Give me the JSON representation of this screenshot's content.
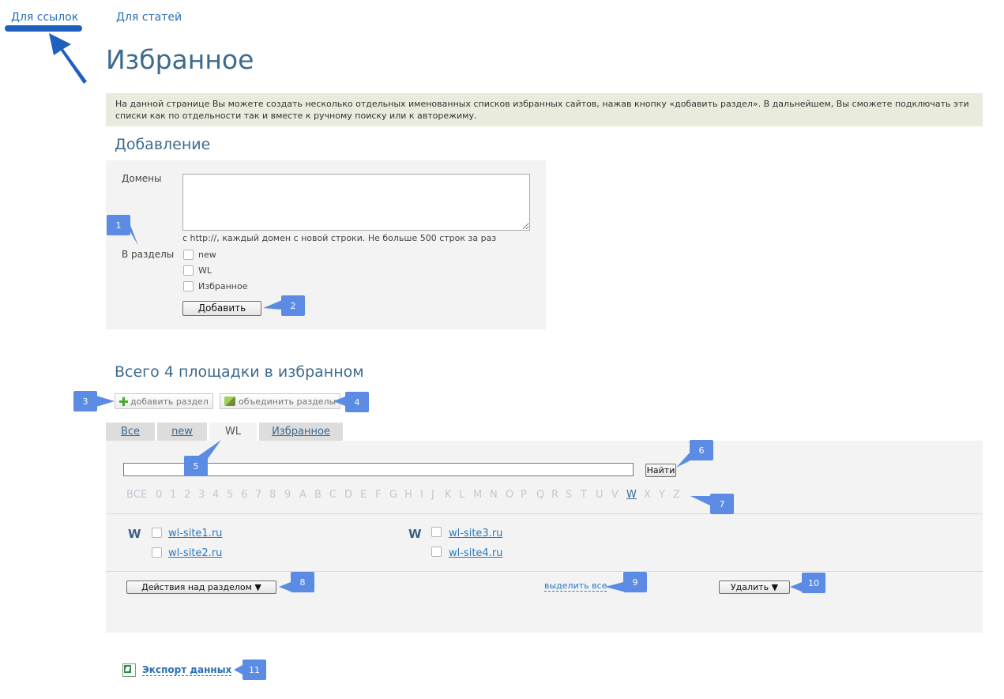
{
  "top_nav": {
    "links": [
      "Для ссылок",
      "Для статей"
    ]
  },
  "page": {
    "title": "Избранное",
    "info": "На данной странице Вы можете создать несколько отдельных именованных списков избранных сайтов, нажав кнопку «добавить раздел». В дальнейшем, Вы сможете подключать эти списки как по отдельности так и вместе к ручному поиску или к авторежиму."
  },
  "add_section": {
    "heading": "Добавление",
    "domains_label": "Домены",
    "domains_value": "",
    "domains_hint": "с http://, каждый домен с новой строки. Не больше 500 строк за раз",
    "sections_label": "В разделы",
    "sections": [
      "new",
      "WL",
      "Избранное"
    ],
    "submit": "Добавить"
  },
  "total_heading": "Всего 4 площадки в избранном",
  "toolbar": {
    "add_section": "добавить раздел",
    "merge_sections": "объединить разделы"
  },
  "tabs": [
    {
      "label": "Все",
      "active": false
    },
    {
      "label": "new",
      "active": false
    },
    {
      "label": "WL",
      "active": true
    },
    {
      "label": "Избранное",
      "active": false
    }
  ],
  "search": {
    "value": "",
    "button": "Найти"
  },
  "alphabet": [
    "ВСЕ",
    "0",
    "1",
    "2",
    "3",
    "4",
    "5",
    "6",
    "7",
    "8",
    "9",
    "A",
    "B",
    "C",
    "D",
    "E",
    "F",
    "G",
    "H",
    "I",
    "J",
    "K",
    "L",
    "M",
    "N",
    "O",
    "P",
    "Q",
    "R",
    "S",
    "T",
    "U",
    "V",
    "W",
    "X",
    "Y",
    "Z"
  ],
  "alphabet_selected": "W",
  "groups": [
    {
      "letter": "W",
      "sites": [
        "wl-site1.ru",
        "wl-site2.ru"
      ]
    },
    {
      "letter": "W",
      "sites": [
        "wl-site3.ru",
        "wl-site4.ru"
      ]
    }
  ],
  "actions": {
    "section_actions": "Действия над разделом ▼",
    "select_all": "выделить все",
    "delete": "Удалить ▼"
  },
  "export": "Экспорт данных",
  "markers": [
    "1",
    "2",
    "3",
    "4",
    "5",
    "6",
    "7",
    "8",
    "9",
    "10",
    "11"
  ],
  "colors": {
    "title": "#3d6b8d",
    "link": "#2a7ac0",
    "marker": "#5b8be3",
    "panel": "#f3f3f3",
    "info_bg": "#e9ecdc"
  }
}
